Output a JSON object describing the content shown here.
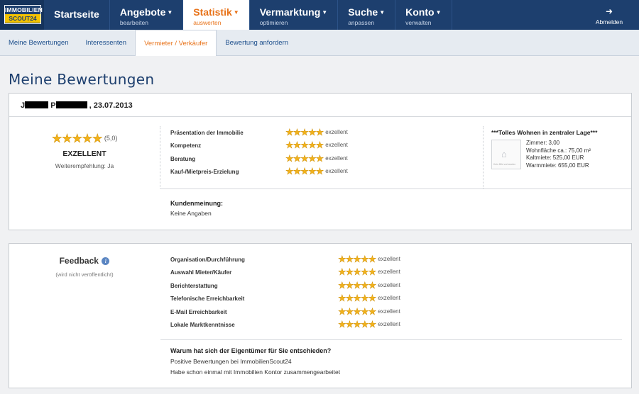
{
  "logo": {
    "line1": "IMMOBILIEN",
    "line2": "SCOUT24"
  },
  "nav": {
    "items": [
      {
        "label": "Startseite",
        "sub": ""
      },
      {
        "label": "Angebote",
        "sub": "bearbeiten"
      },
      {
        "label": "Statistik",
        "sub": "auswerten"
      },
      {
        "label": "Vermarktung",
        "sub": "optimieren"
      },
      {
        "label": "Suche",
        "sub": "anpassen"
      },
      {
        "label": "Konto",
        "sub": "verwalten"
      }
    ],
    "logout": "Abmelden"
  },
  "subnav": {
    "tabs": [
      {
        "label": "Meine Bewertungen"
      },
      {
        "label": "Interessenten"
      },
      {
        "label": "Vermieter / Verkäufer"
      },
      {
        "label": "Bewertung anfordern"
      }
    ]
  },
  "page_title": "Meine Bewertungen",
  "review": {
    "name_initial_1": "J",
    "name_initial_2": "P",
    "date": ", 23.07.2013",
    "overall_stars": 5,
    "overall_score": "(5,0)",
    "overall_word": "EXZELLENT",
    "recommendation": "Weiterempfehlung: Ja",
    "criteria": [
      {
        "label": "Präsentation der Immobilie",
        "stars": 5,
        "word": "exzellent"
      },
      {
        "label": "Kompetenz",
        "stars": 5,
        "word": "exzellent"
      },
      {
        "label": "Beratung",
        "stars": 5,
        "word": "exzellent"
      },
      {
        "label": "Kauf-/Mietpreis-Erzielung",
        "stars": 5,
        "word": "exzellent"
      }
    ],
    "opinion_label": "Kundenmeinung:",
    "opinion_text": "Keine Angaben",
    "listing": {
      "title": "***Tolles Wohnen in zentraler Lage***",
      "image_caption": "Kein Bild vorhanden",
      "facts": [
        "Zimmer: 3,00",
        "Wohnfläche ca.: 75,00 m²",
        "Kaltmiete: 525,00 EUR",
        "Warmmiete: 655,00 EUR"
      ]
    }
  },
  "feedback": {
    "title": "Feedback",
    "note": "(wird nicht veröffentlicht)",
    "criteria": [
      {
        "label": "Organisation/Durchführung",
        "stars": 5,
        "word": "exzellent"
      },
      {
        "label": "Auswahl Mieter/Käufer",
        "stars": 5,
        "word": "exzellent"
      },
      {
        "label": "Berichterstattung",
        "stars": 5,
        "word": "exzellent"
      },
      {
        "label": "Telefonische Erreichbarkeit",
        "stars": 5,
        "word": "exzellent"
      },
      {
        "label": "E-Mail Erreichbarkeit",
        "stars": 5,
        "word": "exzellent"
      },
      {
        "label": "Lokale Marktkenntnisse",
        "stars": 5,
        "word": "exzellent"
      }
    ],
    "question": "Warum hat sich der Eigentümer für Sie entschieden?",
    "answers": [
      "Positive Bewertungen bei ImmobilienScout24",
      "Habe schon einmal mit Immobilien Kontor zusammengearbeitet"
    ]
  },
  "colors": {
    "nav_bg": "#1d3f6e",
    "accent": "#e8731a",
    "star": "#f2b21b",
    "link": "#1d4f8c"
  }
}
